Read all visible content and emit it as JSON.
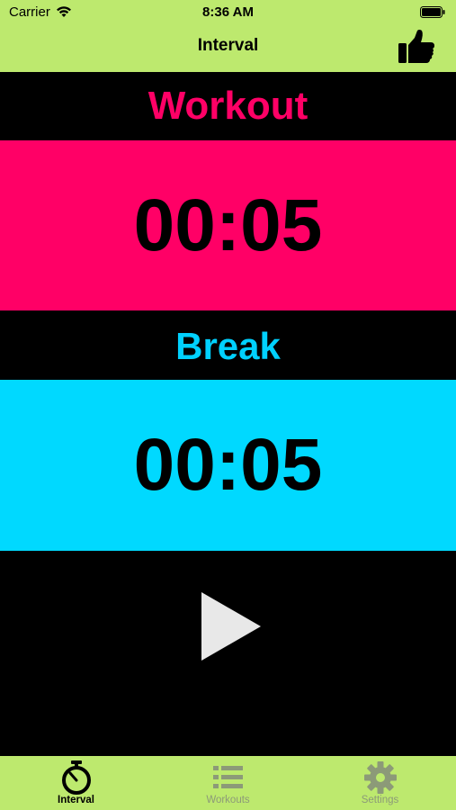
{
  "status_bar": {
    "carrier": "Carrier",
    "time": "8:36 AM"
  },
  "nav": {
    "title": "Interval",
    "right_icon": "thumbs-up-icon"
  },
  "workout": {
    "label": "Workout",
    "time": "00:05",
    "color": "#ff0066"
  },
  "break": {
    "label": "Break",
    "time": "00:05",
    "color": "#00d9ff"
  },
  "controls": {
    "play_icon": "play-icon"
  },
  "tabs": [
    {
      "label": "Interval",
      "icon": "stopwatch-icon",
      "active": true
    },
    {
      "label": "Workouts",
      "icon": "list-icon",
      "active": false
    },
    {
      "label": "Settings",
      "icon": "gear-icon",
      "active": false
    }
  ],
  "colors": {
    "bar_background": "#bde96e",
    "background": "#000000"
  }
}
